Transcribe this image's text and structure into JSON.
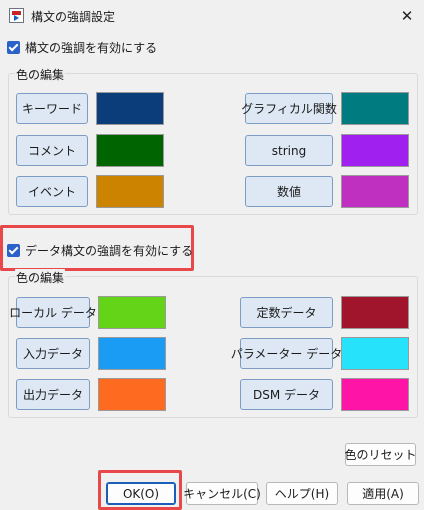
{
  "window": {
    "title": "構文の強調設定"
  },
  "syntax": {
    "enable_label": "構文の強調を有効にする",
    "group_title": "色の編集",
    "left": [
      {
        "label": "キーワード",
        "color": "#0b3d7a"
      },
      {
        "label": "コメント",
        "color": "#006400"
      },
      {
        "label": "イベント",
        "color": "#cc8400"
      }
    ],
    "right": [
      {
        "label": "グラフィカル関数",
        "color": "#007b80"
      },
      {
        "label": "string",
        "color": "#a020f0"
      },
      {
        "label": "数値",
        "color": "#c030c0"
      }
    ]
  },
  "data_syntax": {
    "enable_label": "データ構文の強調を有効にする",
    "group_title": "色の編集",
    "left": [
      {
        "label": "ローカル データ",
        "color": "#64d418"
      },
      {
        "label": "入力データ",
        "color": "#1a9cf5"
      },
      {
        "label": "出力データ",
        "color": "#ff6a21"
      }
    ],
    "right": [
      {
        "label": "定数データ",
        "color": "#a0142c"
      },
      {
        "label": "パラメーター データ",
        "color": "#26e2fa"
      },
      {
        "label": "DSM データ",
        "color": "#ff14a8"
      }
    ]
  },
  "buttons": {
    "reset": "色のリセット",
    "ok": "OK(O)",
    "cancel": "キャンセル(C)",
    "help": "ヘルプ(H)",
    "apply": "適用(A)"
  },
  "colors": {
    "highlight": "#e8484a",
    "checkbox": "#2a62c9"
  }
}
